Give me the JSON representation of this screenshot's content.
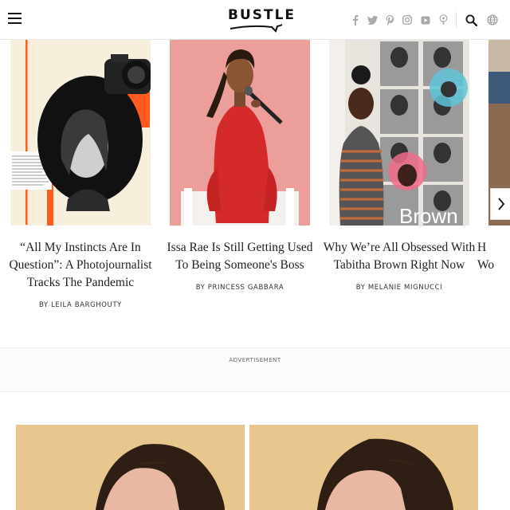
{
  "header": {
    "logo": "BUSTLE",
    "social_icons": [
      "facebook-icon",
      "twitter-icon",
      "pinterest-icon",
      "instagram-icon",
      "youtube-icon",
      "podcast-icon"
    ],
    "utility_icons": [
      "search-icon",
      "globe-icon"
    ]
  },
  "carousel": {
    "cards": [
      {
        "title": "“All My Instincts Are In Question”: A Photojournalist Tracks The Pandemic",
        "byline": "BY LEILA BARGHOUTY"
      },
      {
        "title": "Issa Rae Is Still Getting Used To Being Someone's Boss",
        "byline": "BY PRINCESS GABBARA"
      },
      {
        "title": "Why We’re All Obsessed With Tabitha Brown Right Now",
        "byline": "BY MELANIE MIGNUCCI",
        "image_text": "Brown"
      },
      {
        "title": "H\nWo",
        "byline": ""
      }
    ],
    "next_icon": "chevron-right-icon"
  },
  "ad": {
    "label": "ADVERTISEMENT"
  },
  "colors": {
    "accent_orange": "#ff5a1f",
    "cream": "#f5efdc",
    "pink_bg": "#ec9f9a",
    "red_dress": "#d42a2a",
    "tan": "#e7c78e"
  }
}
